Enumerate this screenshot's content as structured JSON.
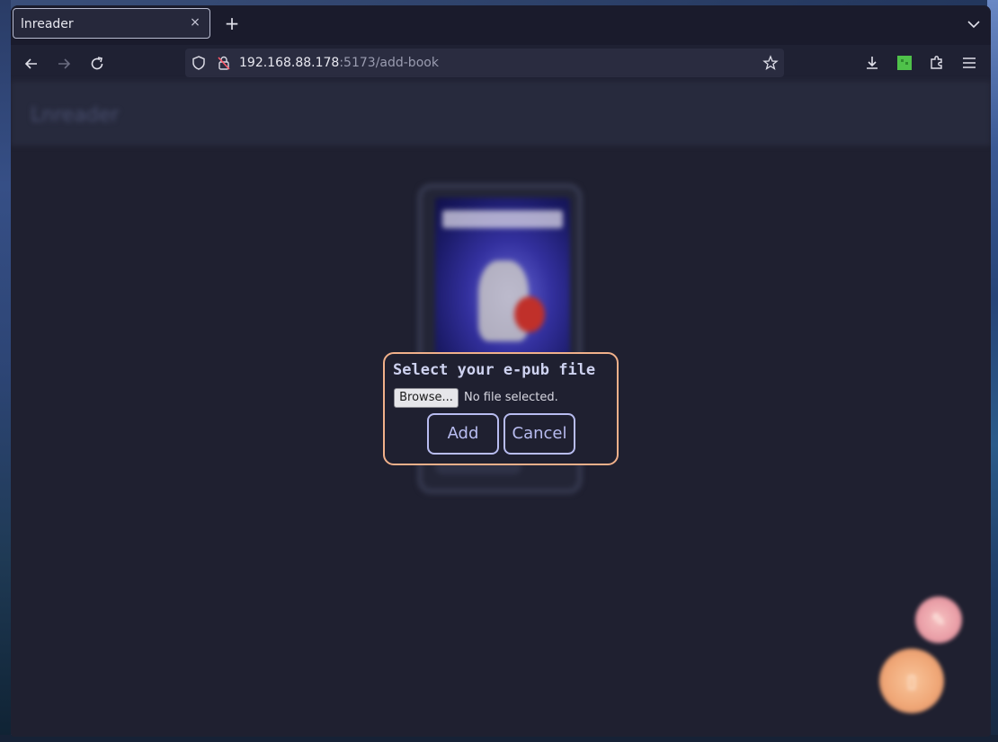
{
  "browser": {
    "tab_title": "lnreader",
    "tab_close": "×",
    "new_tab": "+",
    "url_host": "192.168.88.178",
    "url_rest": ":5173/add-book"
  },
  "app": {
    "brand": "Lnreader"
  },
  "dialog": {
    "title": "Select your e-pub file",
    "browse_label": "Browse...",
    "file_status": "No file selected.",
    "add_label": "Add",
    "cancel_label": "Cancel"
  },
  "icons": {
    "back": "back-arrow-icon",
    "forward": "forward-arrow-icon",
    "reload": "reload-icon",
    "shield": "shield-icon",
    "insecure": "insecure-lock-icon",
    "bookmark": "star-icon",
    "downloads": "download-icon",
    "extension": "green-extension-icon",
    "extensions": "puzzle-icon",
    "menu": "hamburger-menu-icon",
    "tablist": "chevron-down-icon",
    "fab_small": "edit-icon",
    "fab_large": "add-book-icon"
  },
  "colors": {
    "dialog_border": "#f0b08a",
    "button_accent": "#b8bcf0",
    "page_bg": "#1f2030",
    "fab_small": "#eaa0a8",
    "fab_large": "#f0a878"
  }
}
